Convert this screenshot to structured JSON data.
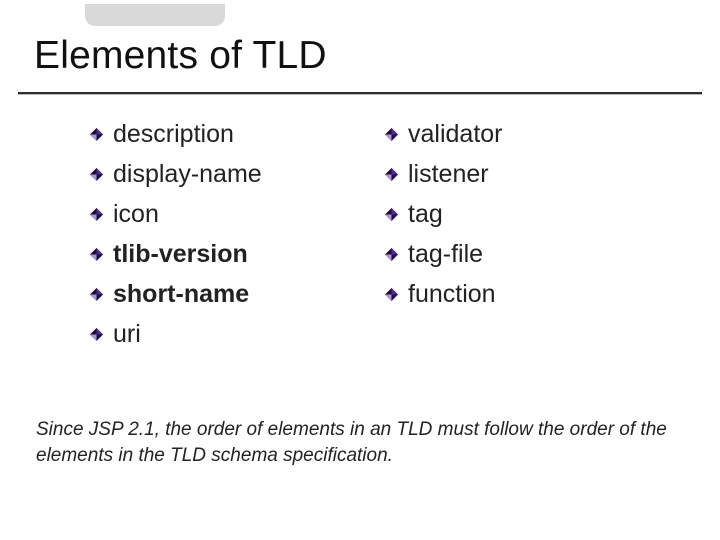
{
  "title": "Elements of TLD",
  "columns": {
    "left": [
      {
        "label": "description",
        "bold": false
      },
      {
        "label": "display-name",
        "bold": false
      },
      {
        "label": "icon",
        "bold": false
      },
      {
        "label": "tlib-version",
        "bold": true
      },
      {
        "label": "short-name",
        "bold": true
      },
      {
        "label": "uri",
        "bold": false
      }
    ],
    "right": [
      {
        "label": "validator",
        "bold": false
      },
      {
        "label": "listener",
        "bold": false
      },
      {
        "label": "tag",
        "bold": false
      },
      {
        "label": "tag-file",
        "bold": false
      },
      {
        "label": "function",
        "bold": false
      }
    ]
  },
  "footnote": "Since JSP 2.1, the order of elements in an TLD must follow the order of the elements in the TLD schema specification.",
  "bullet_icon_name": "diamond-bullet-icon"
}
